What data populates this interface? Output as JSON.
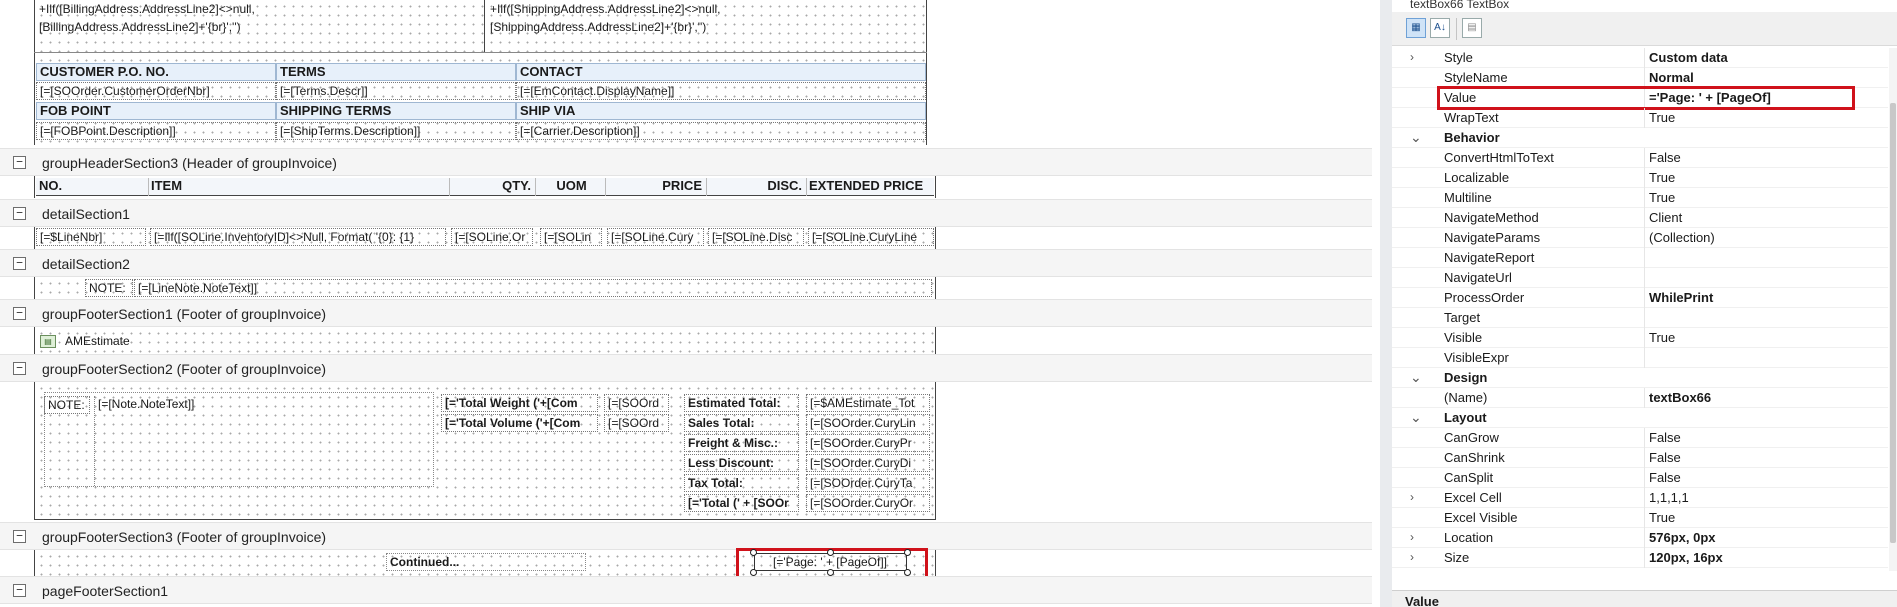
{
  "designer": {
    "address_block": {
      "billing_line1": "+Ilf([BillingAddress.AddressLine2]<>null,",
      "billing_line2": "[BillingAddress.AddressLine2]+'{br}','')",
      "shipping_line1": "+Ilf([ShippingAddress.AddressLine2]<>null,",
      "shipping_line2": "[ShippingAddress.AddressLine2]+'{br}','')"
    },
    "info_table": {
      "h1": [
        "CUSTOMER P.O. NO.",
        "TERMS",
        "CONTACT"
      ],
      "r1": [
        "[=[SOOrder.CustomerOrderNbr]",
        "[=[Terms.Descr]]",
        "[=[EmContact.DisplayName]]"
      ],
      "h2": [
        "FOB POINT",
        "SHIPPING TERMS",
        "SHIP VIA"
      ],
      "r2": [
        "[=[FOBPoint.Description]]",
        "[=[ShipTerms.Description]]",
        "[=[Carrier.Description]]"
      ]
    },
    "sections": {
      "gh3": "groupHeaderSection3 (Header of groupInvoice)",
      "detail1": "detailSection1",
      "detail2": "detailSection2",
      "gf1": "groupFooterSection1 (Footer of groupInvoice)",
      "gf2": "groupFooterSection2 (Footer of groupInvoice)",
      "gf3": "groupFooterSection3 (Footer of groupInvoice)",
      "pf1": "pageFooterSection1"
    },
    "columns": [
      "NO.",
      "ITEM",
      "QTY.",
      "UOM",
      "PRICE",
      "DISC.",
      "EXTENDED PRICE"
    ],
    "detail_cells": [
      "[=$LineNbr]",
      "[=Ilf([SOLine.InventoryID]<>Null, Format( '{0}: {1}",
      "[=[SOLine.Or",
      "[=[SOLin",
      "[=[SOLine.Cury",
      "[=[SOLine.Disc",
      "[=[SOLine.CuryLine"
    ],
    "note_label": "NOTE:",
    "line_note": "[=[LineNote.NoteText]]",
    "subreport": "AMEstimate",
    "footer2": {
      "note_label": "NOTE:",
      "note_text": "[=[Note.NoteText]]",
      "weight": "[='Total Weight ('+[Com",
      "weight_val": "[=[SOOrd",
      "volume": "[='Total Volume ('+[Com",
      "volume_val": "[=[SOOrd",
      "totals_labels": [
        "Estimated Total:",
        "Sales Total:",
        "Freight & Misc.:",
        "Less Discount:",
        "Tax Total:",
        "[='Total (' + [SOOr"
      ],
      "totals_values": [
        "[=$AMEstimate_Tot",
        "[=[SOOrder.CuryLin",
        "[=[SOOrder.CuryPr",
        "[=[SOOrder.CuryDi",
        "[=[SOOrder.CuryTa",
        "[=[SOOrder.CuryOr"
      ]
    },
    "continued": "Continued...",
    "page_box": "[='Page: ' + [PageOf]]"
  },
  "properties": {
    "header": "textBox66 TextBox",
    "toolbar_icons": [
      "categorized-icon",
      "alphabetical-icon",
      "property-pages-icon"
    ],
    "rows": [
      {
        "type": "prop",
        "caret": ">",
        "name": "Style",
        "value": "Custom data",
        "bold": true
      },
      {
        "type": "prop",
        "caret": "",
        "name": "StyleName",
        "value": "Normal",
        "bold": true
      },
      {
        "type": "prop",
        "caret": "",
        "name": "Value",
        "value": "='Page: ' + [PageOf]",
        "bold": true,
        "highlight": true
      },
      {
        "type": "prop",
        "caret": "",
        "name": "WrapText",
        "value": "True",
        "bold": false
      },
      {
        "type": "cat",
        "caret": "v",
        "name": "Behavior",
        "value": "",
        "bold": false
      },
      {
        "type": "prop",
        "caret": "",
        "name": "ConvertHtmlToText",
        "value": "False",
        "bold": false
      },
      {
        "type": "prop",
        "caret": "",
        "name": "Localizable",
        "value": "True",
        "bold": false
      },
      {
        "type": "prop",
        "caret": "",
        "name": "Multiline",
        "value": "True",
        "bold": false
      },
      {
        "type": "prop",
        "caret": "",
        "name": "NavigateMethod",
        "value": "Client",
        "bold": false
      },
      {
        "type": "prop",
        "caret": "",
        "name": "NavigateParams",
        "value": "(Collection)",
        "bold": false
      },
      {
        "type": "prop",
        "caret": "",
        "name": "NavigateReport",
        "value": "",
        "bold": false
      },
      {
        "type": "prop",
        "caret": "",
        "name": "NavigateUrl",
        "value": "",
        "bold": false
      },
      {
        "type": "prop",
        "caret": "",
        "name": "ProcessOrder",
        "value": "WhilePrint",
        "bold": true
      },
      {
        "type": "prop",
        "caret": "",
        "name": "Target",
        "value": "",
        "bold": false
      },
      {
        "type": "prop",
        "caret": "",
        "name": "Visible",
        "value": "True",
        "bold": false
      },
      {
        "type": "prop",
        "caret": "",
        "name": "VisibleExpr",
        "value": "",
        "bold": false
      },
      {
        "type": "cat",
        "caret": "v",
        "name": "Design",
        "value": "",
        "bold": false
      },
      {
        "type": "prop",
        "caret": "",
        "name": "(Name)",
        "value": "textBox66",
        "bold": true
      },
      {
        "type": "cat",
        "caret": "v",
        "name": "Layout",
        "value": "",
        "bold": false
      },
      {
        "type": "prop",
        "caret": "",
        "name": "CanGrow",
        "value": "False",
        "bold": false
      },
      {
        "type": "prop",
        "caret": "",
        "name": "CanShrink",
        "value": "False",
        "bold": false
      },
      {
        "type": "prop",
        "caret": "",
        "name": "CanSplit",
        "value": "False",
        "bold": false
      },
      {
        "type": "prop",
        "caret": ">",
        "name": "Excel Cell",
        "value": "1,1,1,1",
        "bold": false
      },
      {
        "type": "prop",
        "caret": "",
        "name": "Excel Visible",
        "value": "True",
        "bold": false
      },
      {
        "type": "prop",
        "caret": ">",
        "name": "Location",
        "value": "576px, 0px",
        "bold": true
      },
      {
        "type": "prop",
        "caret": ">",
        "name": "Size",
        "value": "120px, 16px",
        "bold": true
      }
    ],
    "description_title": "Value"
  },
  "colors": {
    "highlight": "#d0121b",
    "section_bar": "#f5f5f5",
    "header_fill": "#e7f0fa"
  }
}
